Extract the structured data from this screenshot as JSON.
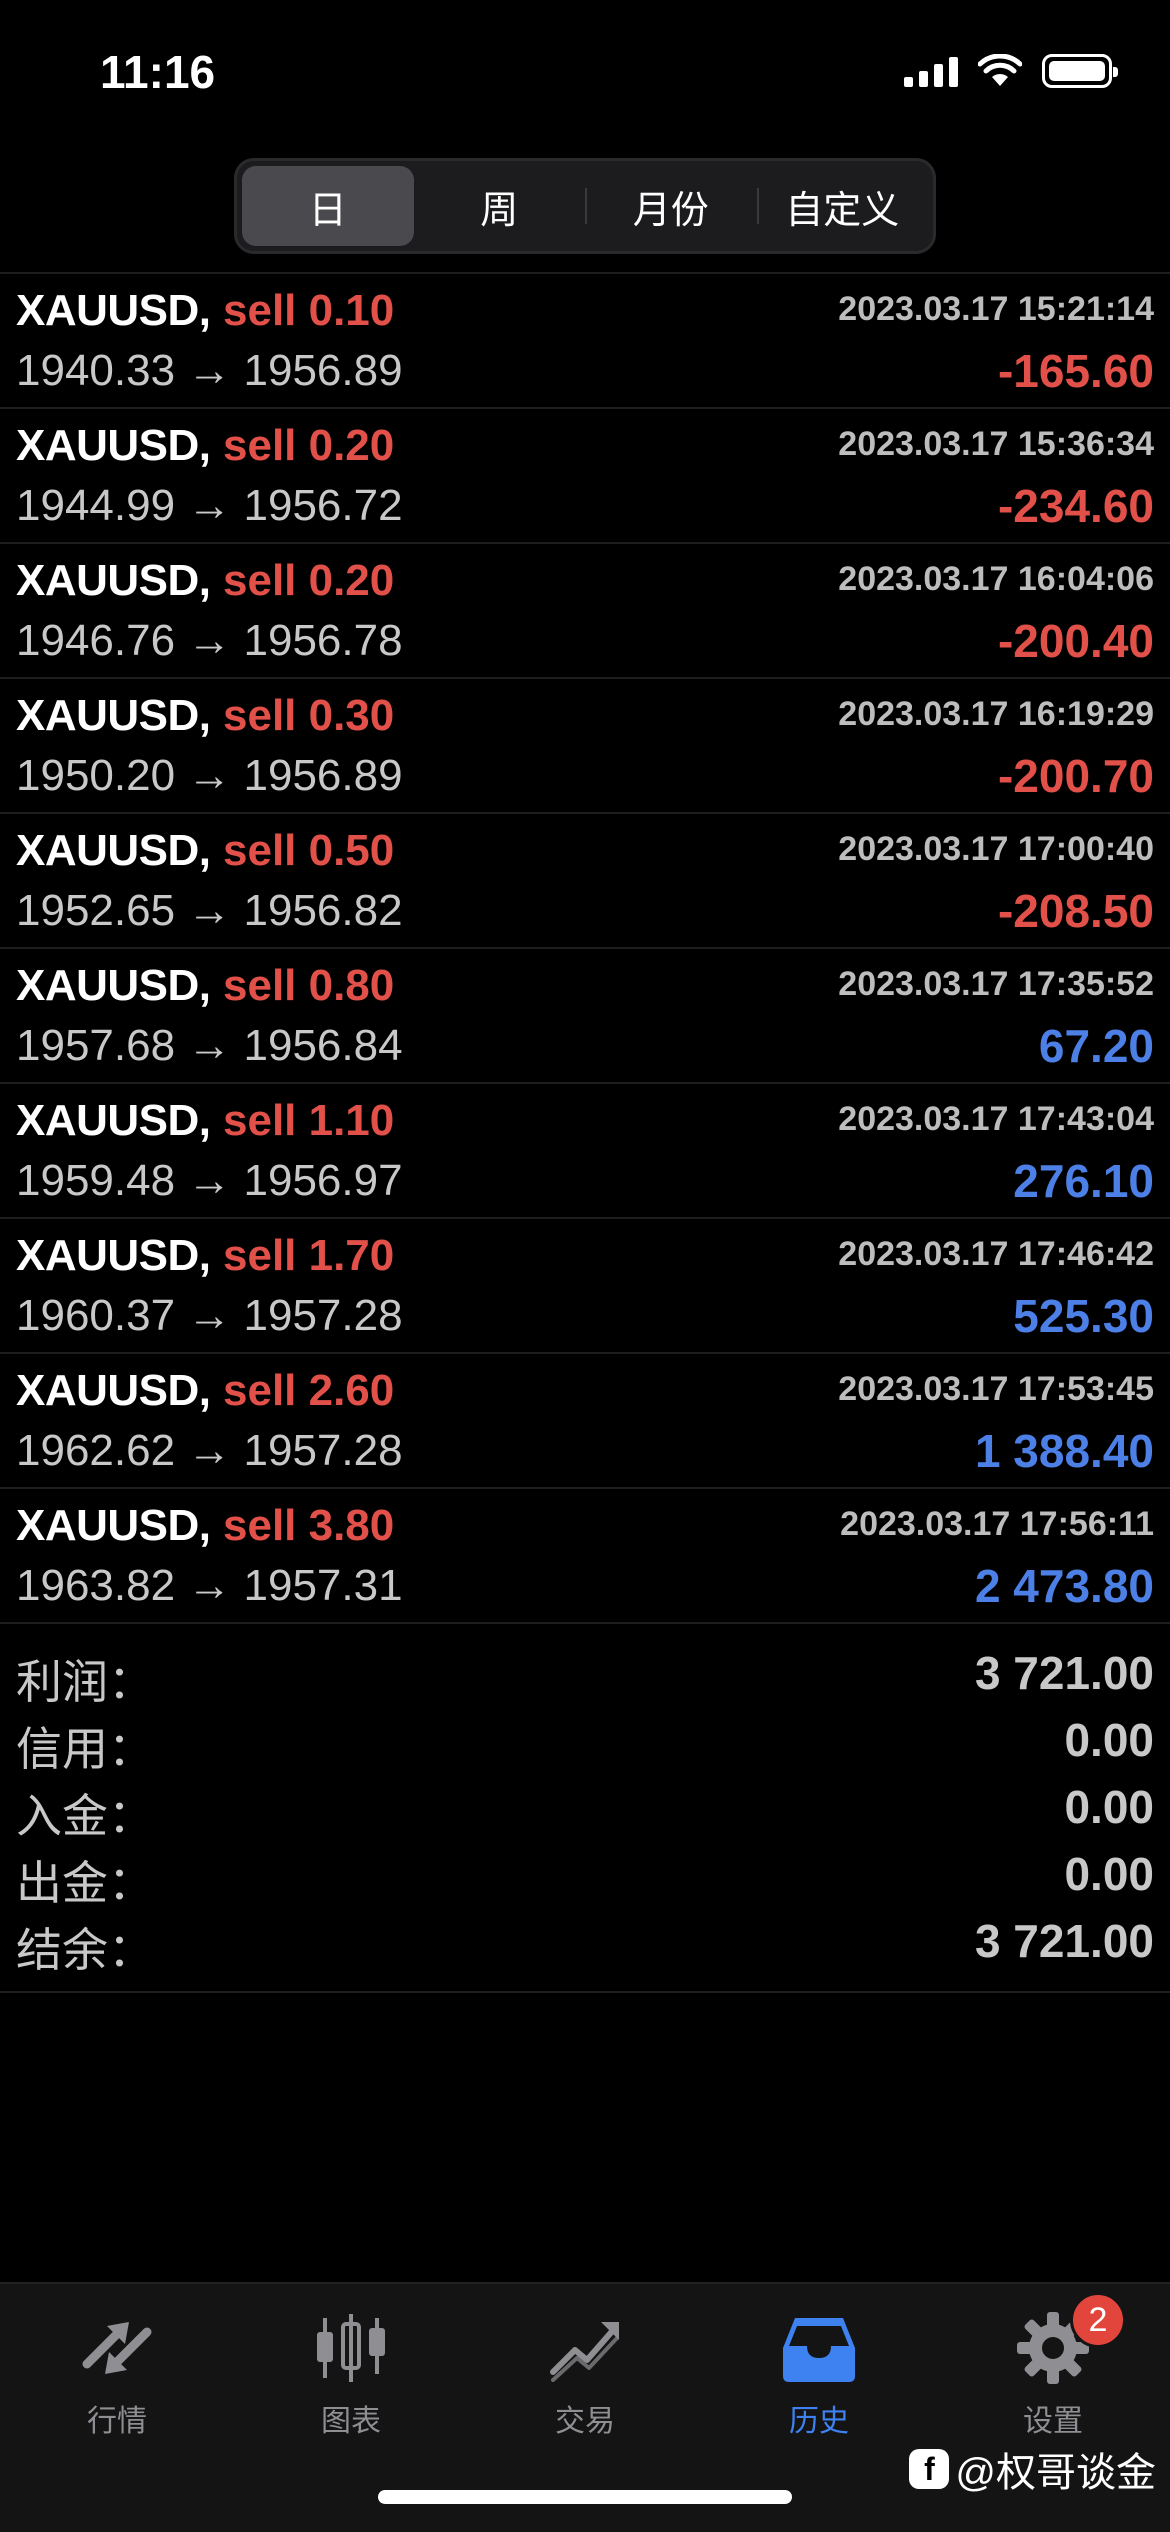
{
  "status_bar": {
    "time": "11:16"
  },
  "segmented": {
    "tabs": [
      {
        "label": "日",
        "active": true
      },
      {
        "label": "周",
        "active": false
      },
      {
        "label": "月份",
        "active": false
      },
      {
        "label": "自定义",
        "active": false
      }
    ]
  },
  "trades": [
    {
      "symbol": "XAUUSD,",
      "side": "sell 0.10",
      "time": "2023.03.17 15:21:14",
      "prices": "1940.33 → 1956.89",
      "profit": "-165.60"
    },
    {
      "symbol": "XAUUSD,",
      "side": "sell 0.20",
      "time": "2023.03.17 15:36:34",
      "prices": "1944.99 → 1956.72",
      "profit": "-234.60"
    },
    {
      "symbol": "XAUUSD,",
      "side": "sell 0.20",
      "time": "2023.03.17 16:04:06",
      "prices": "1946.76 → 1956.78",
      "profit": "-200.40"
    },
    {
      "symbol": "XAUUSD,",
      "side": "sell 0.30",
      "time": "2023.03.17 16:19:29",
      "prices": "1950.20 → 1956.89",
      "profit": "-200.70"
    },
    {
      "symbol": "XAUUSD,",
      "side": "sell 0.50",
      "time": "2023.03.17 17:00:40",
      "prices": "1952.65 → 1956.82",
      "profit": "-208.50"
    },
    {
      "symbol": "XAUUSD,",
      "side": "sell 0.80",
      "time": "2023.03.17 17:35:52",
      "prices": "1957.68 → 1956.84",
      "profit": "67.20"
    },
    {
      "symbol": "XAUUSD,",
      "side": "sell 1.10",
      "time": "2023.03.17 17:43:04",
      "prices": "1959.48 → 1956.97",
      "profit": "276.10"
    },
    {
      "symbol": "XAUUSD,",
      "side": "sell 1.70",
      "time": "2023.03.17 17:46:42",
      "prices": "1960.37 → 1957.28",
      "profit": "525.30"
    },
    {
      "symbol": "XAUUSD,",
      "side": "sell 2.60",
      "time": "2023.03.17 17:53:45",
      "prices": "1962.62 → 1957.28",
      "profit": "1 388.40"
    },
    {
      "symbol": "XAUUSD,",
      "side": "sell 3.80",
      "time": "2023.03.17 17:56:11",
      "prices": "1963.82 → 1957.31",
      "profit": "2 473.80"
    }
  ],
  "summary": [
    {
      "label": "利润：",
      "value": "3 721.00"
    },
    {
      "label": "信用：",
      "value": "0.00"
    },
    {
      "label": "入金：",
      "value": "0.00"
    },
    {
      "label": "出金：",
      "value": "0.00"
    },
    {
      "label": "结余：",
      "value": "3 721.00"
    }
  ],
  "tab_bar": {
    "tabs": [
      {
        "label": "行情",
        "icon": "quotes-arrows-icon",
        "active": false
      },
      {
        "label": "图表",
        "icon": "candlestick-chart-icon",
        "active": false
      },
      {
        "label": "交易",
        "icon": "trade-trend-icon",
        "active": false
      },
      {
        "label": "历史",
        "icon": "history-inbox-icon",
        "active": true
      },
      {
        "label": "设置",
        "icon": "gear-icon",
        "active": false,
        "badge": "2"
      }
    ]
  },
  "watermark": {
    "text": "@权哥谈金"
  },
  "colors": {
    "loss": "#e2504a",
    "profit": "#4d80e6",
    "active_tab": "#3d82f0",
    "badge": "#e2453c"
  }
}
